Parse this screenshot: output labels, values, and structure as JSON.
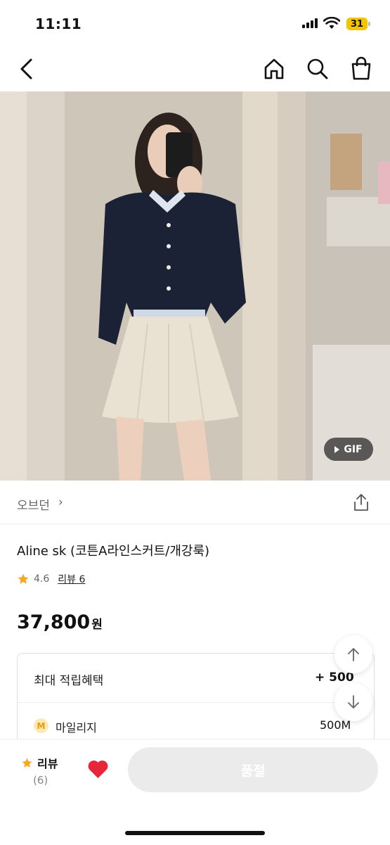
{
  "status_bar": {
    "time": "11:11",
    "battery": "31"
  },
  "nav": {
    "back_icon": "chevron-left-icon",
    "home_icon": "home-icon",
    "search_icon": "search-icon",
    "cart_icon": "shopping-bag-icon"
  },
  "product_image": {
    "badge_label": "GIF"
  },
  "brand": {
    "name": "오브던",
    "chevron": "›"
  },
  "product": {
    "title": "Aline sk (코튼A라인스커트/개강룩)",
    "rating": "4.6",
    "review_link": "리뷰 6",
    "price": "37,800",
    "price_unit": "원"
  },
  "benefits": {
    "title": "최대 적립혜택",
    "total": "+ 500",
    "mileage_badge": "M",
    "mileage_label": "마일리지",
    "mileage_value": "500M"
  },
  "bottom_bar": {
    "review_label": "리뷰",
    "review_count": "(6)",
    "purchase_label": "품절"
  },
  "colors": {
    "star": "#f5a623",
    "heart": "#e8263a",
    "disabled_button": "#ebebeb"
  }
}
